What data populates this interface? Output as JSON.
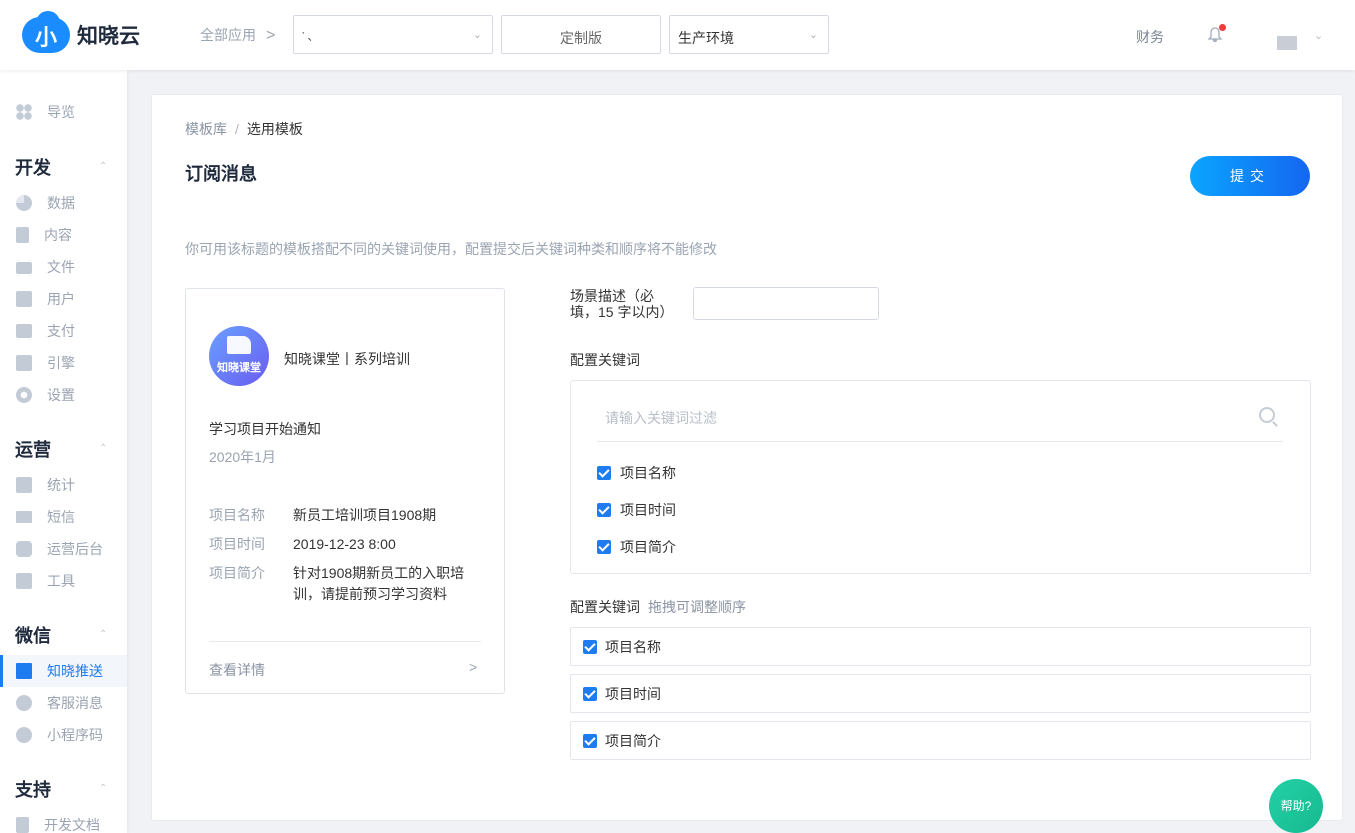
{
  "header": {
    "brand_glyph": "小",
    "brand": "知晓云",
    "all_apps": "全部应用",
    "app_select_value": "‵   、",
    "edition": "定制版",
    "env_select_value": "生产环境",
    "finance": "财务"
  },
  "sidebar": {
    "overview": "导览",
    "groups": {
      "dev": "开发",
      "ops": "运营",
      "wechat": "微信",
      "support": "支持"
    },
    "items": {
      "data": "数据",
      "content": "内容",
      "files": "文件",
      "users": "用户",
      "pay": "支付",
      "engine": "引擎",
      "settings": "设置",
      "stats": "统计",
      "sms": "短信",
      "ops_backend": "运营后台",
      "tools": "工具",
      "push": "知晓推送",
      "cs": "客服消息",
      "miniprogram": "小程序码",
      "devdocs": "开发文档"
    }
  },
  "main": {
    "breadcrumb": [
      "模板库",
      "选用模板"
    ],
    "breadcrumb_sep": "/",
    "title": "订阅消息",
    "submit": "提交",
    "hint": "你可用该标题的模板搭配不同的关键词使用，配置提交后关键词种类和顺序将不能修改",
    "preview": {
      "logo_text": "知晓课堂",
      "name": "知晓课堂丨系列培训",
      "message": "学习项目开始通知",
      "date": "2020年1月",
      "rows": [
        {
          "k": "项目名称",
          "v": "新员工培训项目1908期"
        },
        {
          "k": "项目时间",
          "v": "2019-12-23 8:00"
        },
        {
          "k": "项目简介",
          "v": "针对1908期新员工的入职培训，请提前预习学习资料"
        }
      ],
      "more": "查看详情"
    },
    "form": {
      "scene_label": "场景描述（必填，15 字以内）",
      "scene_value": "",
      "keywords_label": "配置关键词",
      "filter_placeholder": "请输入关键词过滤",
      "keyword_options": [
        "项目名称",
        "项目时间",
        "项目简介"
      ],
      "order_label": "配置关键词",
      "order_hint": "拖拽可调整顺序",
      "order_items": [
        "项目名称",
        "项目时间",
        "项目简介"
      ]
    }
  },
  "help": "帮助?"
}
